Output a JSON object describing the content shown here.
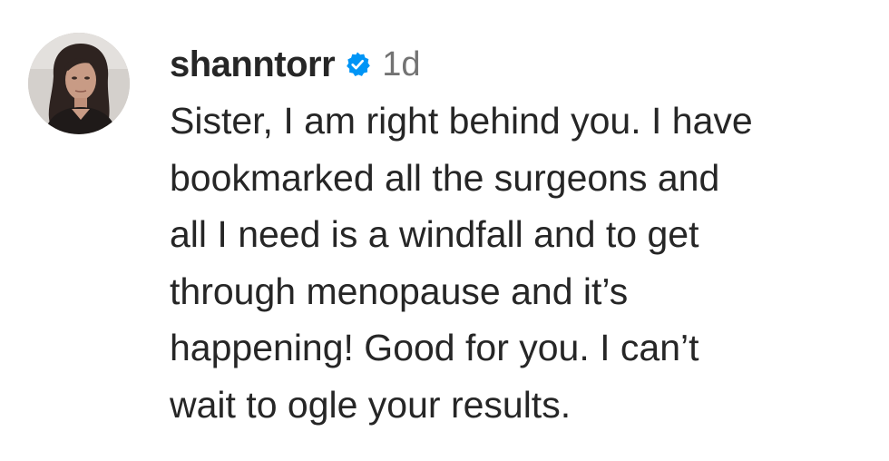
{
  "comment": {
    "username": "shanntorr",
    "verified": true,
    "timestamp": "1d",
    "text_lines": [
      "Sister, I am right behind you. I have",
      "bookmarked all the surgeons and",
      "all I need is a windfall and to get",
      "through menopause and it’s",
      "happening! Good for you. I can’t",
      "wait to ogle your results."
    ],
    "verified_color": "#0095f6"
  }
}
